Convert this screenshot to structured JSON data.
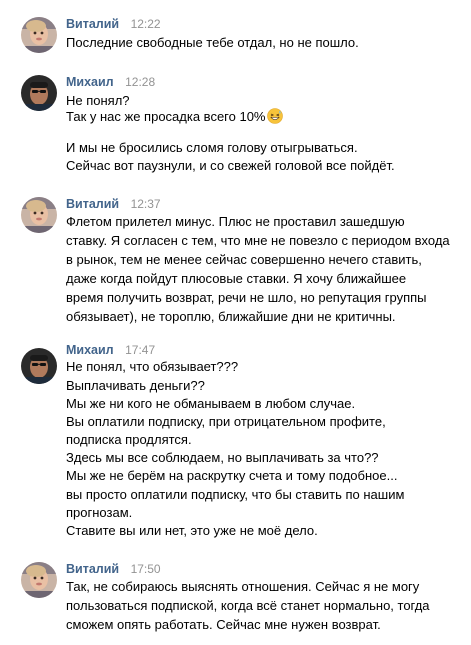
{
  "messages": [
    {
      "author": "Виталий",
      "time": "12:22",
      "avatar_icon": "user-photo-vitaly",
      "lines": [
        "Последние свободные тебе отдал, но не пошло."
      ]
    },
    {
      "author": "Михаил",
      "time": "12:28",
      "avatar_icon": "user-photo-mikhail",
      "lines": [
        "Не понял?",
        "Так у нас же просадка всего 10%",
        "И мы не бросились сломя голову отыгрываться.",
        "Сейчас вот паузнули, и со свежей головой все пойдёт."
      ],
      "emoji": "grinning-sweat-emoji"
    },
    {
      "author": "Виталий",
      "time": "12:37",
      "avatar_icon": "user-photo-vitaly",
      "lines": [
        "Флетом прилетел минус. Плюс не проставил зашедшую",
        "ставку. Я согласен с тем, что мне не повезло с периодом входа",
        "в рынок, тем не менее сейчас совершенно нечего ставить,",
        "даже когда пойдут плюсовые ставки. Я хочу ближайшее",
        "время получить возврат, речи не шло, но репутация группы",
        "обязывает), не тороплю, ближайшие дни не критичны."
      ]
    },
    {
      "author": "Михаил",
      "time": "17:47",
      "avatar_icon": "user-photo-mikhail",
      "lines": [
        "Не понял, что обязывает???",
        "Выплачивать деньги??",
        "Мы же ни кого не обманываем в любом случае.",
        "Вы оплатили подписку, при отрицательном профите,",
        "подписка продлятся.",
        "Здесь мы все соблюдаем, но выплачивать за что??",
        "Мы же не берём на раскрутку счета и тому подобное...",
        "вы просто оплатили подписку, что бы ставить по нашим",
        "прогнозам.",
        "Ставите вы или нет, это уже не моё дело."
      ]
    },
    {
      "author": "Виталий",
      "time": "17:50",
      "avatar_icon": "user-photo-vitaly",
      "lines": [
        "Так, не собираюсь выяснять отношения. Сейчас я не могу",
        "пользоваться подпиской, когда всё станет нормально, тогда",
        "сможем опять работать. Сейчас мне нужен возврат."
      ]
    }
  ],
  "colors": {
    "author": "#42648b",
    "time": "#939393",
    "text": "#000000",
    "background": "#ffffff"
  }
}
